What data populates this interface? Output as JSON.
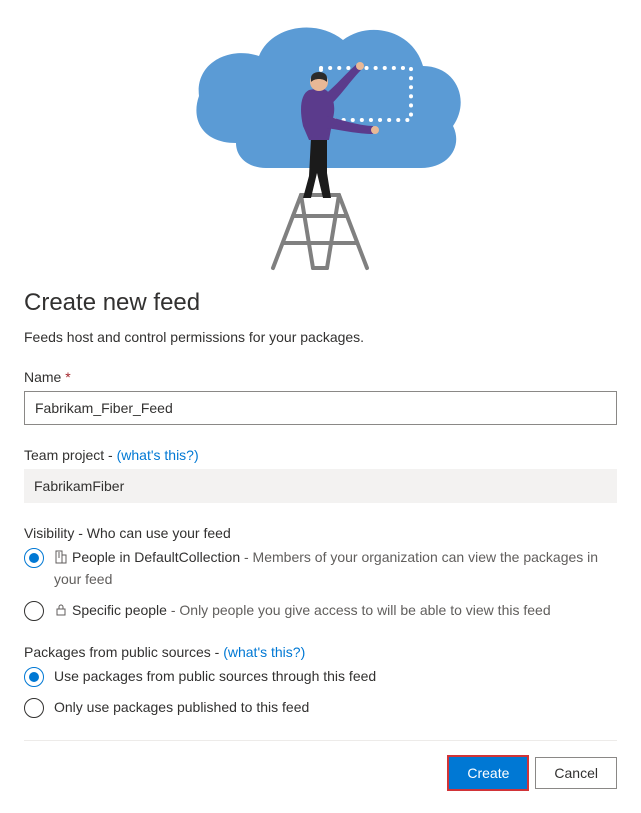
{
  "header": {
    "title": "Create new feed",
    "subtitle": "Feeds host and control permissions for your packages."
  },
  "name_field": {
    "label": "Name",
    "required_marker": "*",
    "value": "Fabrikam_Fiber_Feed"
  },
  "team_project": {
    "label_prefix": "Team project - ",
    "help_text": "(what's this?)",
    "value": "FabrikamFiber"
  },
  "visibility": {
    "heading": "Visibility - Who can use your feed",
    "options": [
      {
        "name_hint": "People in DefaultCollection",
        "desc": " - Members of your organization can view the packages in your feed",
        "checked": true,
        "icon": "org"
      },
      {
        "name_hint": "Specific people",
        "desc": " - Only people you give access to will be able to view this feed",
        "checked": false,
        "icon": "lock"
      }
    ]
  },
  "public_sources": {
    "heading_prefix": "Packages from public sources - ",
    "help_text": "(what's this?)",
    "options": [
      {
        "label": "Use packages from public sources through this feed",
        "checked": true
      },
      {
        "label": "Only use packages published to this feed",
        "checked": false
      }
    ]
  },
  "buttons": {
    "primary": "Create",
    "secondary": "Cancel"
  }
}
